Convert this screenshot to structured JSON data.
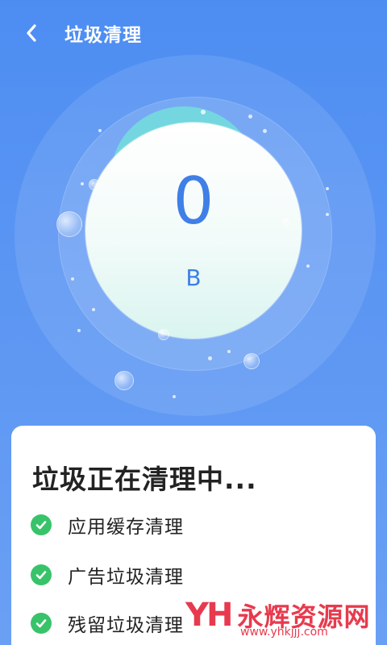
{
  "header": {
    "title": "垃圾清理",
    "back_icon": "chevron-left-icon"
  },
  "cleaner": {
    "size_value": "0",
    "size_unit": "B"
  },
  "card": {
    "title": "垃圾正在清理中...",
    "tasks": [
      {
        "label": "应用缓存清理",
        "status": "done"
      },
      {
        "label": "广告垃圾清理",
        "status": "done"
      },
      {
        "label": "残留垃圾清理",
        "status": "done"
      }
    ]
  },
  "watermark": {
    "logo": "YH",
    "text": "永辉资源网",
    "url": "www.yhkjjj.com"
  },
  "colors": {
    "background": "#4d8df2",
    "accent": "#3f7fe6",
    "check": "#38c36a",
    "teal": "#74d6df",
    "watermark": "#e83a4e"
  }
}
